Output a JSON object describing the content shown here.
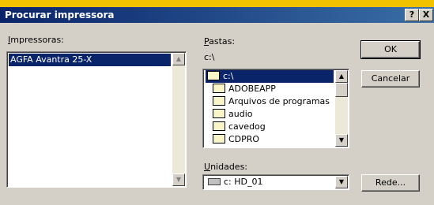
{
  "window": {
    "title": "Procurar impressora",
    "help_btn": "?",
    "close_btn": "X"
  },
  "printers": {
    "label_u": "I",
    "label_rest": "mpressoras:",
    "items": [
      "AGFA Avantra 25-X"
    ]
  },
  "folders": {
    "label_u": "P",
    "label_rest": "astas:",
    "current_path": "c:\\",
    "items": [
      "c:\\",
      "ADOBEAPP",
      "Arquivos de programas",
      "audio",
      "cavedog",
      "CDPRO"
    ]
  },
  "drives": {
    "label_u": "U",
    "label_rest": "nidades:",
    "selected": "c: HD_01"
  },
  "buttons": {
    "ok": "OK",
    "cancel": "Cancelar",
    "network": "Rede..."
  },
  "scroll_glyphs": {
    "up": "▲",
    "down": "▼"
  },
  "colors": {
    "titlebar_start": "#0a246a",
    "titlebar_end": "#3a6ea5",
    "selection": "#0a246a",
    "desktop": "#f2c200"
  }
}
